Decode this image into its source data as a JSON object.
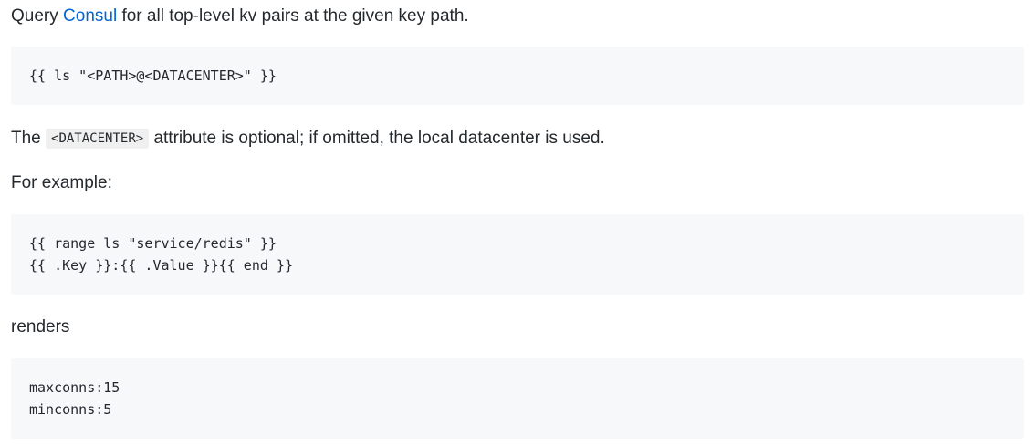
{
  "para1": {
    "before": "Query ",
    "link": "Consul",
    "after": " for all top-level kv pairs at the given key path."
  },
  "code1": {
    "lines": [
      "{{ ls \"<PATH>@<DATACENTER>\" }}"
    ]
  },
  "para2": {
    "before": "The ",
    "code": "<DATACENTER>",
    "after": " attribute is optional; if omitted, the local datacenter is used."
  },
  "para3": "For example:",
  "code2": {
    "lines": [
      "{{ range ls \"service/redis\" }}",
      "{{ .Key }}:{{ .Value }}{{ end }}"
    ]
  },
  "para4": "renders",
  "code3": {
    "lines": [
      "maxconns:15",
      "minconns:5"
    ]
  },
  "colors": {
    "link": "#0366d6",
    "code_bg": "#f6f8fa",
    "text": "#24292e"
  }
}
